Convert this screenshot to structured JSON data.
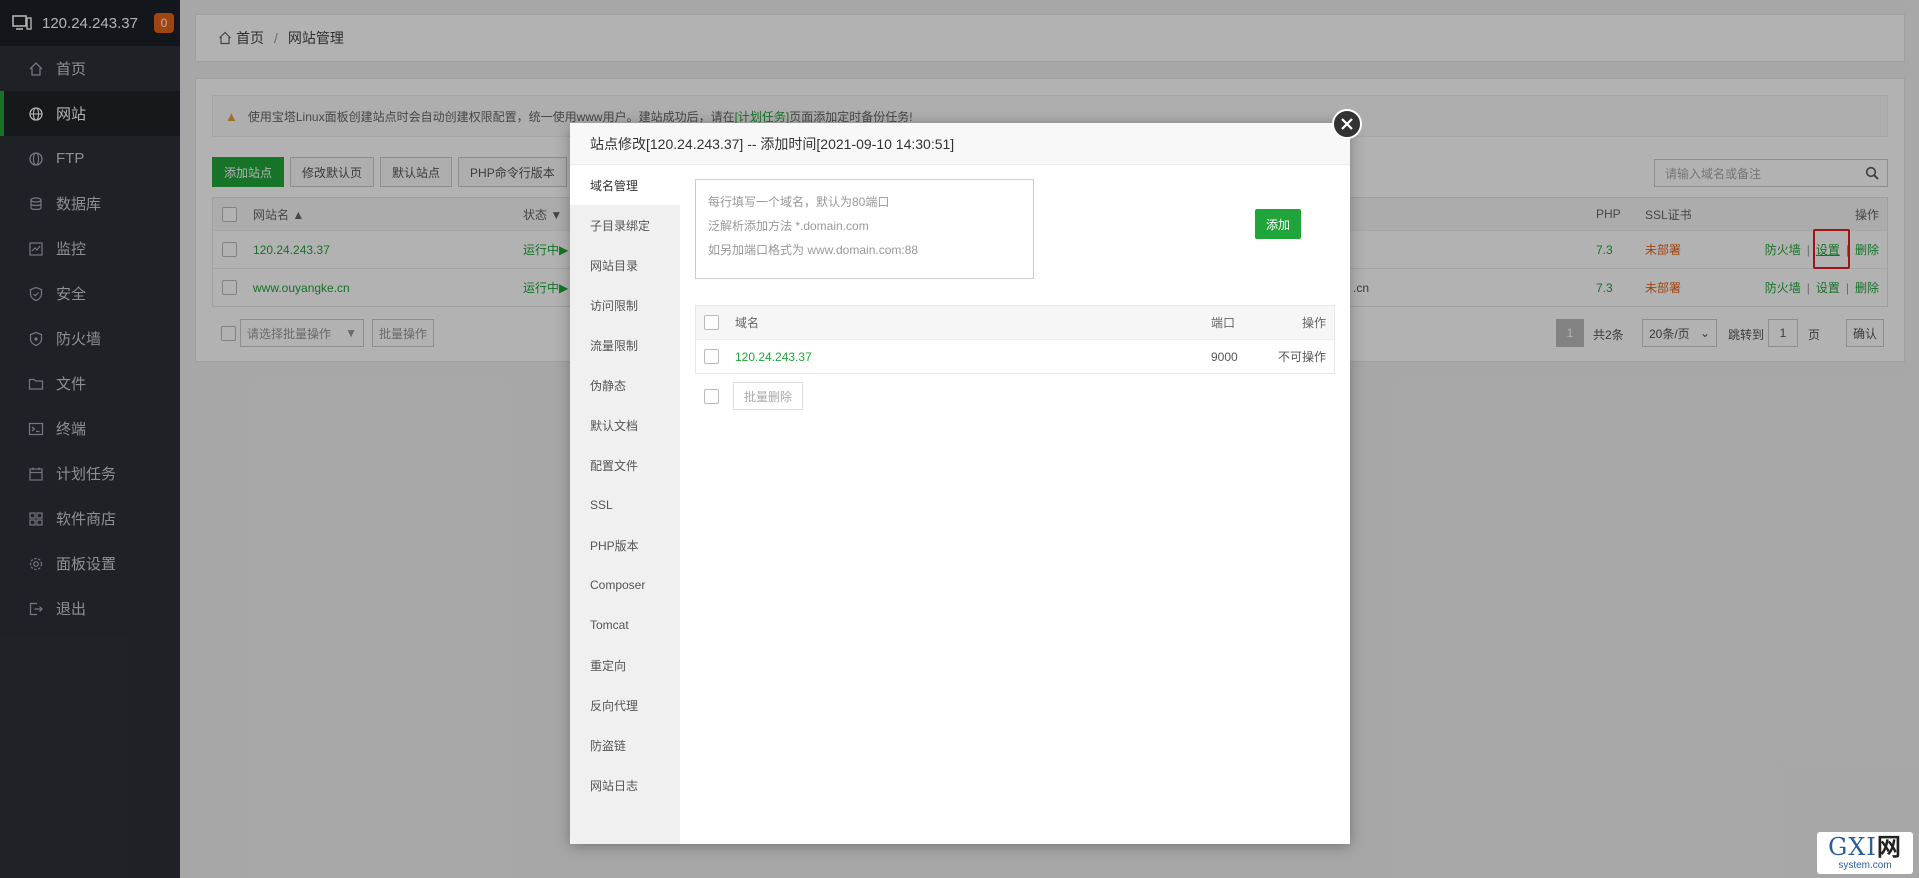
{
  "sidebar": {
    "server_ip": "120.24.243.37",
    "badge_count": "0",
    "items": [
      {
        "label": "首页",
        "icon": "home-icon"
      },
      {
        "label": "网站",
        "icon": "globe-icon"
      },
      {
        "label": "FTP",
        "icon": "ftp-icon"
      },
      {
        "label": "数据库",
        "icon": "database-icon"
      },
      {
        "label": "监控",
        "icon": "monitor-icon"
      },
      {
        "label": "安全",
        "icon": "shield-icon"
      },
      {
        "label": "防火墙",
        "icon": "firewall-icon"
      },
      {
        "label": "文件",
        "icon": "folder-icon"
      },
      {
        "label": "终端",
        "icon": "terminal-icon"
      },
      {
        "label": "计划任务",
        "icon": "calendar-icon"
      },
      {
        "label": "软件商店",
        "icon": "apps-icon"
      },
      {
        "label": "面板设置",
        "icon": "gear-icon"
      },
      {
        "label": "退出",
        "icon": "logout-icon"
      }
    ],
    "active_index": 1
  },
  "breadcrumb": {
    "home": "首页",
    "sep": "/",
    "current": "网站管理"
  },
  "notice": {
    "text_before": "使用宝塔Linux面板创建站点时会自动创建权限配置，统一使用www用户。建站成功后，请在",
    "link": "[计划任务]",
    "text_after": "页面添加定时备份任务!"
  },
  "toolbar": {
    "buttons": [
      "添加站点",
      "修改默认页",
      "默认站点",
      "PHP命令行版本"
    ],
    "search_placeholder": "请输入域名或备注"
  },
  "site_table": {
    "headers": {
      "name": "网站名",
      "status": "状态",
      "php": "PHP",
      "ssl": "SSL证书",
      "ops": "操作"
    },
    "rows": [
      {
        "name": "120.24.243.37",
        "status": "运行中▶",
        "extra": "",
        "php": "7.3",
        "ssl": "未部署",
        "op_firewall": "防火墙",
        "op_settings": "设置",
        "op_delete": "删除"
      },
      {
        "name": "www.ouyangke.cn",
        "status": "运行中▶",
        "extra": ".cn",
        "php": "7.3",
        "ssl": "未部署",
        "op_firewall": "防火墙",
        "op_settings": "设置",
        "op_delete": "删除"
      }
    ],
    "op_sep": "|"
  },
  "table_footer": {
    "batch_select": "请选择批量操作",
    "batch_button": "批量操作",
    "page": "1",
    "total": "共2条",
    "per_page": "20条/页",
    "goto_label": "跳转到",
    "goto_value": "1",
    "page_unit": "页",
    "confirm": "确认"
  },
  "modal": {
    "title": "站点修改[120.24.243.37] -- 添加时间[2021-09-10 14:30:51]",
    "menu": [
      "域名管理",
      "子目录绑定",
      "网站目录",
      "访问限制",
      "流量限制",
      "伪静态",
      "默认文档",
      "配置文件",
      "SSL",
      "PHP版本",
      "Composer",
      "Tomcat",
      "重定向",
      "反向代理",
      "防盗链",
      "网站日志"
    ],
    "active_menu_index": 0,
    "textarea_hints": [
      "每行填写一个域名，默认为80端口",
      "泛解析添加方法 *.domain.com",
      "如另加端口格式为 www.domain.com:88"
    ],
    "add_button": "添加",
    "domain_table": {
      "headers": {
        "domain": "域名",
        "port": "端口",
        "ops": "操作"
      },
      "rows": [
        {
          "domain": "120.24.243.37",
          "port": "9000",
          "op": "不可操作"
        }
      ]
    },
    "bulk_delete": "批量删除"
  },
  "watermark": {
    "brand_g": "G",
    "brand_x": "X",
    "brand_i": "I",
    "brand_cn": "网",
    "domain": "system.com"
  },
  "colors": {
    "accent_green": "#20a53a",
    "warning_orange": "#e5631b",
    "sidebar_bg": "#2c3138",
    "highlight_red": "#e02020"
  }
}
